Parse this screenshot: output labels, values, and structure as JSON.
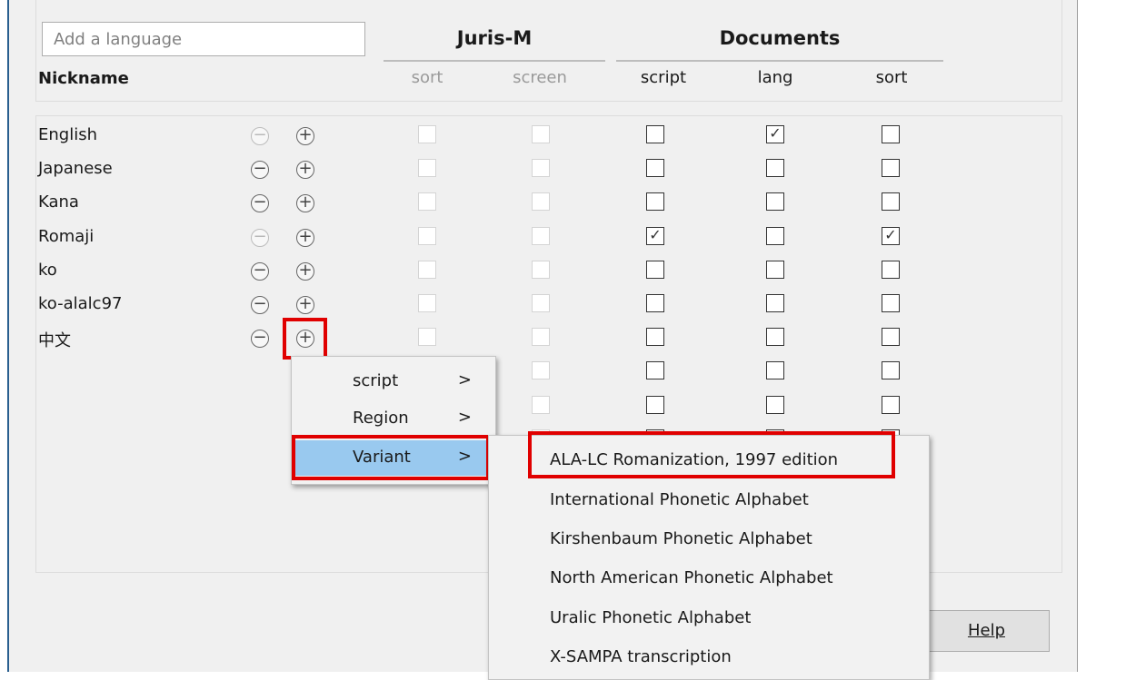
{
  "search": {
    "placeholder": "Add a language"
  },
  "headers": {
    "nickname": "Nickname",
    "jurism": "Juris-M",
    "documents": "Documents",
    "jurism_cols": [
      "sort",
      "screen"
    ],
    "documents_cols": [
      "script",
      "lang",
      "sort"
    ]
  },
  "rows": [
    {
      "nickname": "English",
      "minus_enabled": false,
      "script": false,
      "lang": true,
      "sort": false
    },
    {
      "nickname": "Japanese",
      "minus_enabled": true,
      "script": false,
      "lang": false,
      "sort": false
    },
    {
      "nickname": "Kana",
      "minus_enabled": true,
      "script": false,
      "lang": false,
      "sort": false
    },
    {
      "nickname": "Romaji",
      "minus_enabled": false,
      "script": true,
      "lang": false,
      "sort": true
    },
    {
      "nickname": "ko",
      "minus_enabled": true,
      "script": false,
      "lang": false,
      "sort": false
    },
    {
      "nickname": "ko-alalc97",
      "minus_enabled": true,
      "script": false,
      "lang": false,
      "sort": false
    },
    {
      "nickname": "中文",
      "minus_enabled": true,
      "script": false,
      "lang": false,
      "sort": false
    },
    {
      "nickname": "",
      "script": false,
      "lang": false,
      "sort": false
    },
    {
      "nickname": "",
      "script": false,
      "lang": false,
      "sort": false
    },
    {
      "nickname": "",
      "script": false,
      "lang": false,
      "sort": false
    }
  ],
  "context_menu": {
    "items": [
      {
        "label": "script",
        "arrow": ">"
      },
      {
        "label": "Region",
        "arrow": ">"
      },
      {
        "label": "Variant",
        "arrow": ">",
        "selected": true
      }
    ]
  },
  "variant_menu": {
    "items": [
      "ALA-LC Romanization, 1997 edition",
      "International Phonetic Alphabet",
      "Kirshenbaum Phonetic Alphabet",
      "North American Phonetic Alphabet",
      "Uralic Phonetic Alphabet",
      "X-SAMPA transcription"
    ]
  },
  "footer": {
    "help_label": "Help"
  },
  "colors": {
    "highlight": "#e00000",
    "selected": "#99c9ef",
    "window_border": "#2a5f8f"
  }
}
